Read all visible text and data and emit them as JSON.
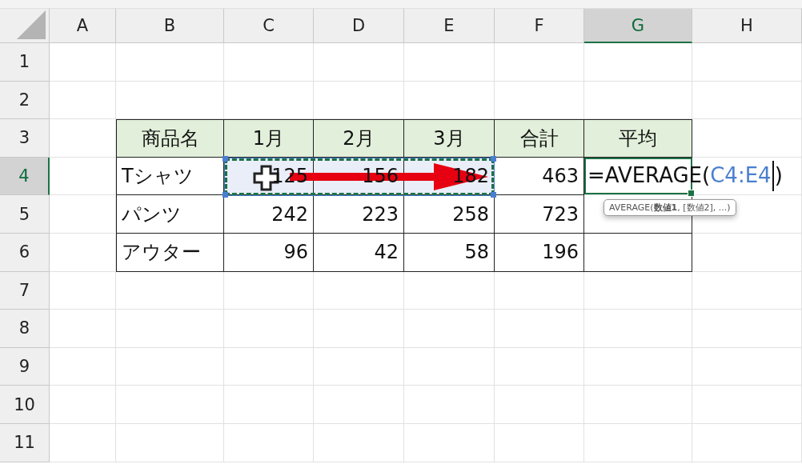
{
  "column_headers": [
    {
      "label": "A",
      "selected": false
    },
    {
      "label": "B",
      "selected": false
    },
    {
      "label": "C",
      "selected": false
    },
    {
      "label": "D",
      "selected": false
    },
    {
      "label": "E",
      "selected": false
    },
    {
      "label": "F",
      "selected": false
    },
    {
      "label": "G",
      "selected": true
    },
    {
      "label": "H",
      "selected": false
    }
  ],
  "row_headers": [
    {
      "label": "1",
      "selected": false
    },
    {
      "label": "2",
      "selected": false
    },
    {
      "label": "3",
      "selected": false
    },
    {
      "label": "4",
      "selected": true
    },
    {
      "label": "5",
      "selected": false
    },
    {
      "label": "6",
      "selected": false
    },
    {
      "label": "7",
      "selected": false
    },
    {
      "label": "8",
      "selected": false
    },
    {
      "label": "9",
      "selected": false
    },
    {
      "label": "10",
      "selected": false
    },
    {
      "label": "11",
      "selected": false
    }
  ],
  "table": {
    "columns": [
      "商品名",
      "1月",
      "2月",
      "3月",
      "合計",
      "平均"
    ],
    "rows": [
      {
        "cells": [
          {
            "text": "Tシャツ",
            "referenced": false
          },
          {
            "text": "125",
            "referenced": true
          },
          {
            "text": "156",
            "referenced": true
          },
          {
            "text": "182",
            "referenced": true
          },
          {
            "text": "463",
            "referenced": false
          }
        ]
      },
      {
        "cells": [
          {
            "text": "パンツ",
            "referenced": false
          },
          {
            "text": "242",
            "referenced": false
          },
          {
            "text": "223",
            "referenced": false
          },
          {
            "text": "258",
            "referenced": false
          },
          {
            "text": "723",
            "referenced": false
          }
        ]
      },
      {
        "cells": [
          {
            "text": "アウター",
            "referenced": false
          },
          {
            "text": "96",
            "referenced": false
          },
          {
            "text": "42",
            "referenced": false
          },
          {
            "text": "58",
            "referenced": false
          },
          {
            "text": "196",
            "referenced": false
          }
        ]
      }
    ]
  },
  "formula_cell": {
    "prefix": "=AVERAGE(",
    "reference": "C4:E4",
    "suffix": ")"
  },
  "tooltip": "AVERAGE(**数値1**, [数値2], ...)"
}
